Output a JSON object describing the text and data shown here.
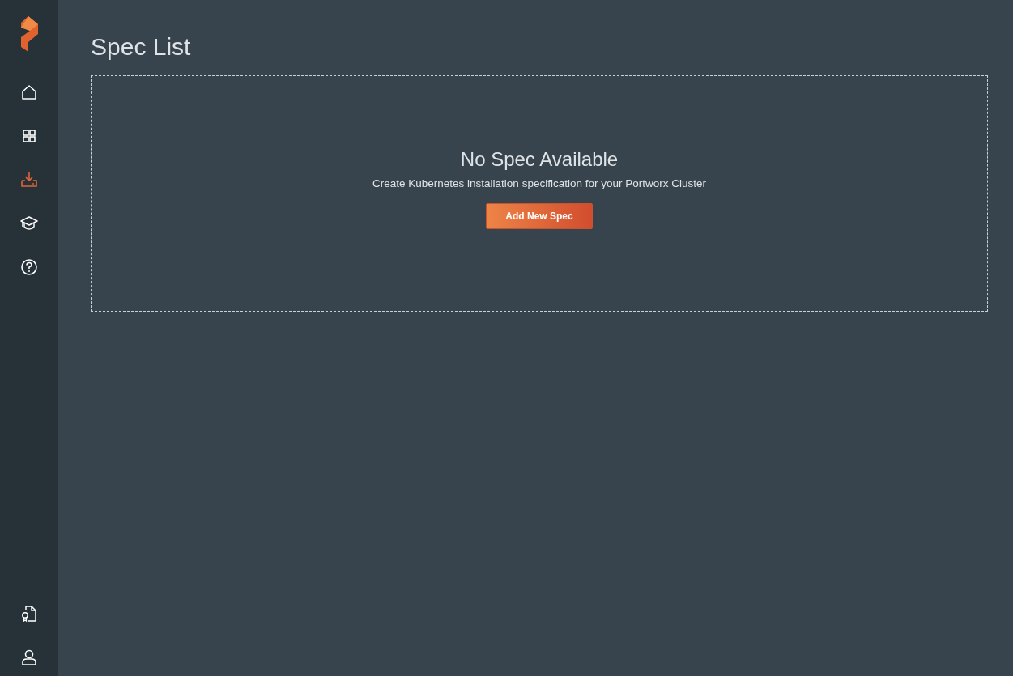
{
  "sidebar": {
    "items": [
      {
        "kind": "home",
        "selected": false
      },
      {
        "kind": "grid",
        "selected": false
      },
      {
        "kind": "download",
        "selected": true
      },
      {
        "kind": "learn",
        "selected": false
      },
      {
        "kind": "help",
        "selected": false
      }
    ],
    "bottom_items": [
      {
        "kind": "license",
        "selected": false
      },
      {
        "kind": "user",
        "selected": false
      }
    ]
  },
  "page": {
    "title": "Spec List"
  },
  "empty_state": {
    "heading": "No Spec Available",
    "message": "Create Kubernetes installation specification for your Portworx Cluster",
    "button": "Add New Spec"
  }
}
